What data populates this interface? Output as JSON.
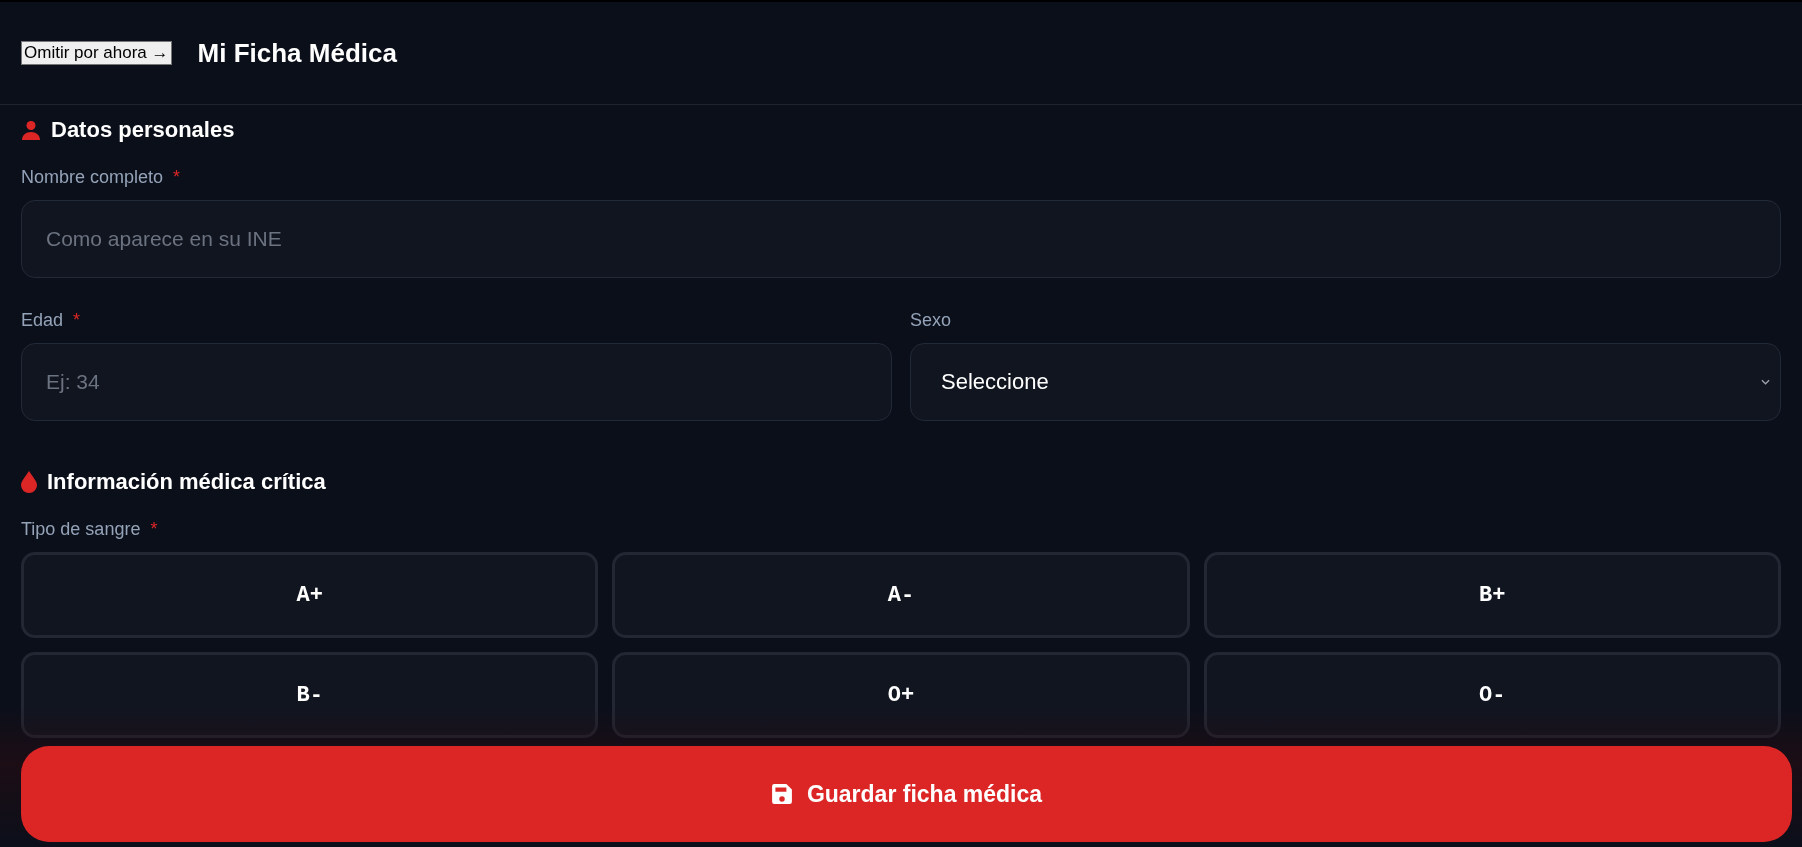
{
  "header": {
    "skip_button": "Omitir por ahora →",
    "title": "Mi Ficha Médica"
  },
  "personal": {
    "title": "Datos personales",
    "full_name": {
      "label": "Nombre completo",
      "required_mark": "*",
      "placeholder": "Como aparece en su INE"
    },
    "age": {
      "label": "Edad",
      "required_mark": "*",
      "placeholder": "Ej: 34"
    },
    "sex": {
      "label": "Sexo",
      "value": "Seleccione"
    }
  },
  "medical": {
    "title": "Información médica crítica",
    "blood_type": {
      "label": "Tipo de sangre",
      "required_mark": "*",
      "options": [
        {
          "label": "A+",
          "selected": false
        },
        {
          "label": "A-",
          "selected": false
        },
        {
          "label": "B+",
          "selected": false
        },
        {
          "label": "B-",
          "selected": false
        },
        {
          "label": "O+",
          "selected": false
        },
        {
          "label": "O-",
          "selected": false
        }
      ]
    }
  },
  "save_button": "Guardar ficha médica"
}
